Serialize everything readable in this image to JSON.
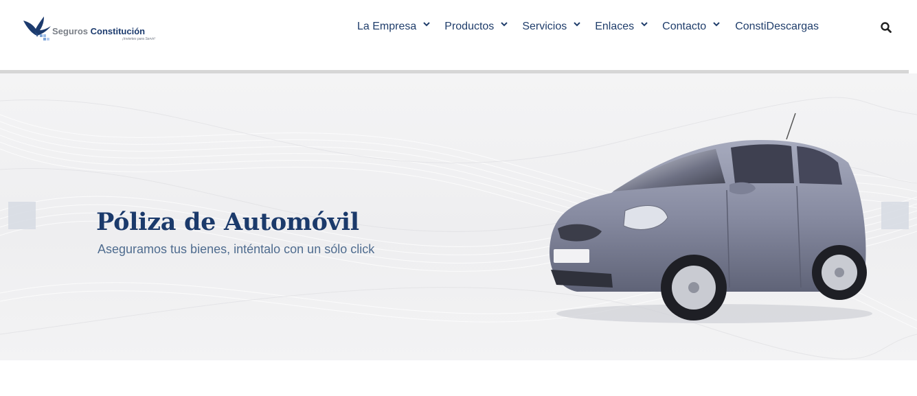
{
  "brand": {
    "name_part1": "Seguros",
    "name_part2": "Constitución",
    "tagline": "¡Inviertes para Servir!",
    "logo_icon": "eagle-logo-icon"
  },
  "nav": {
    "items": [
      {
        "label": "La Empresa",
        "has_dropdown": true
      },
      {
        "label": "Productos",
        "has_dropdown": true
      },
      {
        "label": "Servicios",
        "has_dropdown": true
      },
      {
        "label": "Enlaces",
        "has_dropdown": true
      },
      {
        "label": "Contacto",
        "has_dropdown": true
      },
      {
        "label": "ConstiDescargas",
        "has_dropdown": false
      }
    ],
    "search_icon": "search-icon"
  },
  "hero": {
    "title": "Póliza de Automóvil",
    "subtitle": "Aseguramos tus bienes, inténtalo con un sólo click",
    "image": "car-image",
    "prev_icon": "slider-prev-arrow",
    "next_icon": "slider-next-arrow"
  },
  "colors": {
    "brand_navy": "#1f3d6b",
    "subtitle": "#4f6c8f",
    "divider": "#d6d6d6",
    "car_body": "#8a8ea3"
  }
}
